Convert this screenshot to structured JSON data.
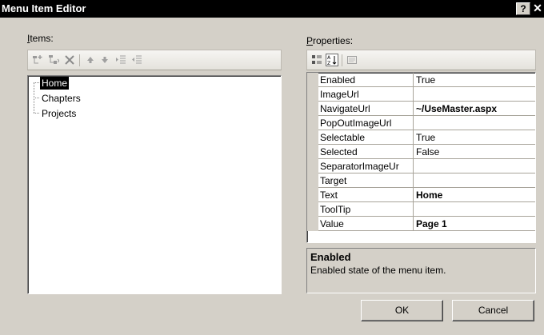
{
  "window": {
    "title": "Menu Item Editor",
    "help_label": "?",
    "close_label": "✕"
  },
  "items_panel": {
    "label_access": "I",
    "label_rest": "tems:",
    "toolbar_icons": [
      "add-root-item-icon",
      "add-child-item-icon",
      "remove-item-icon",
      "move-up-icon",
      "move-down-icon",
      "indent-icon",
      "outdent-icon"
    ],
    "tree": [
      {
        "label": "Home",
        "selected": true
      },
      {
        "label": "Chapters",
        "selected": false
      },
      {
        "label": "Projects",
        "selected": false
      }
    ]
  },
  "properties_panel": {
    "label_access": "P",
    "label_rest": "roperties:",
    "toolbar_icons": [
      "categorized-icon",
      "alphabetical-icon",
      "property-pages-icon"
    ],
    "rows": [
      {
        "name": "Enabled",
        "value": "True",
        "bold": false
      },
      {
        "name": "ImageUrl",
        "value": "",
        "bold": false
      },
      {
        "name": "NavigateUrl",
        "value": "~/UseMaster.aspx",
        "bold": true
      },
      {
        "name": "PopOutImageUrl",
        "value": "",
        "bold": false
      },
      {
        "name": "Selectable",
        "value": "True",
        "bold": false
      },
      {
        "name": "Selected",
        "value": "False",
        "bold": false
      },
      {
        "name": "SeparatorImageUr",
        "value": "",
        "bold": false
      },
      {
        "name": "Target",
        "value": "",
        "bold": false
      },
      {
        "name": "Text",
        "value": "Home",
        "bold": true
      },
      {
        "name": "ToolTip",
        "value": "",
        "bold": false
      },
      {
        "name": "Value",
        "value": "Page 1",
        "bold": true
      }
    ],
    "description_title": "Enabled",
    "description_text": "Enabled state of the menu item."
  },
  "buttons": {
    "ok": "OK",
    "cancel": "Cancel"
  }
}
